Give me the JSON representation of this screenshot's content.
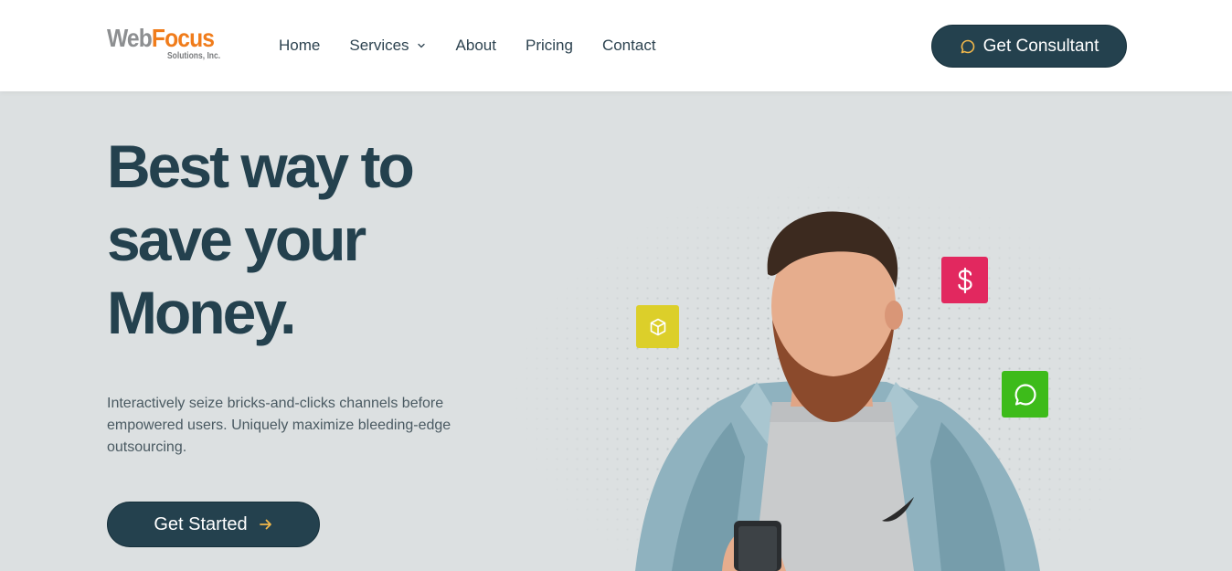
{
  "header": {
    "logo": {
      "text_primary": "Web",
      "text_accent": "Focus",
      "subtitle": "Solutions, Inc."
    },
    "nav": [
      {
        "label": "Home"
      },
      {
        "label": "Services",
        "has_dropdown": true
      },
      {
        "label": "About"
      },
      {
        "label": "Pricing"
      },
      {
        "label": "Contact"
      }
    ],
    "cta": {
      "label": "Get Consultant",
      "icon": "chat-bubble-icon"
    }
  },
  "hero": {
    "title_lines": [
      "Best way to",
      "save your",
      "Money."
    ],
    "description": "Interactively seize bricks-and-clicks channels before empowered users. Uniquely maximize bleeding-edge outsourcing.",
    "cta": {
      "label": "Get Started",
      "icon": "arrow-right-icon"
    }
  },
  "illustration": {
    "badges": [
      {
        "icon": "cube-icon",
        "color": "#dccf2a"
      },
      {
        "icon": "dollar-icon",
        "color": "#e2285f"
      },
      {
        "icon": "chat-bubble-icon",
        "color": "#3dbb1a"
      }
    ]
  },
  "colors": {
    "primary": "#24414e",
    "logo_accent": "#f07c1b",
    "background": "#dce0e1",
    "arrow_accent": "#f2b84b"
  }
}
